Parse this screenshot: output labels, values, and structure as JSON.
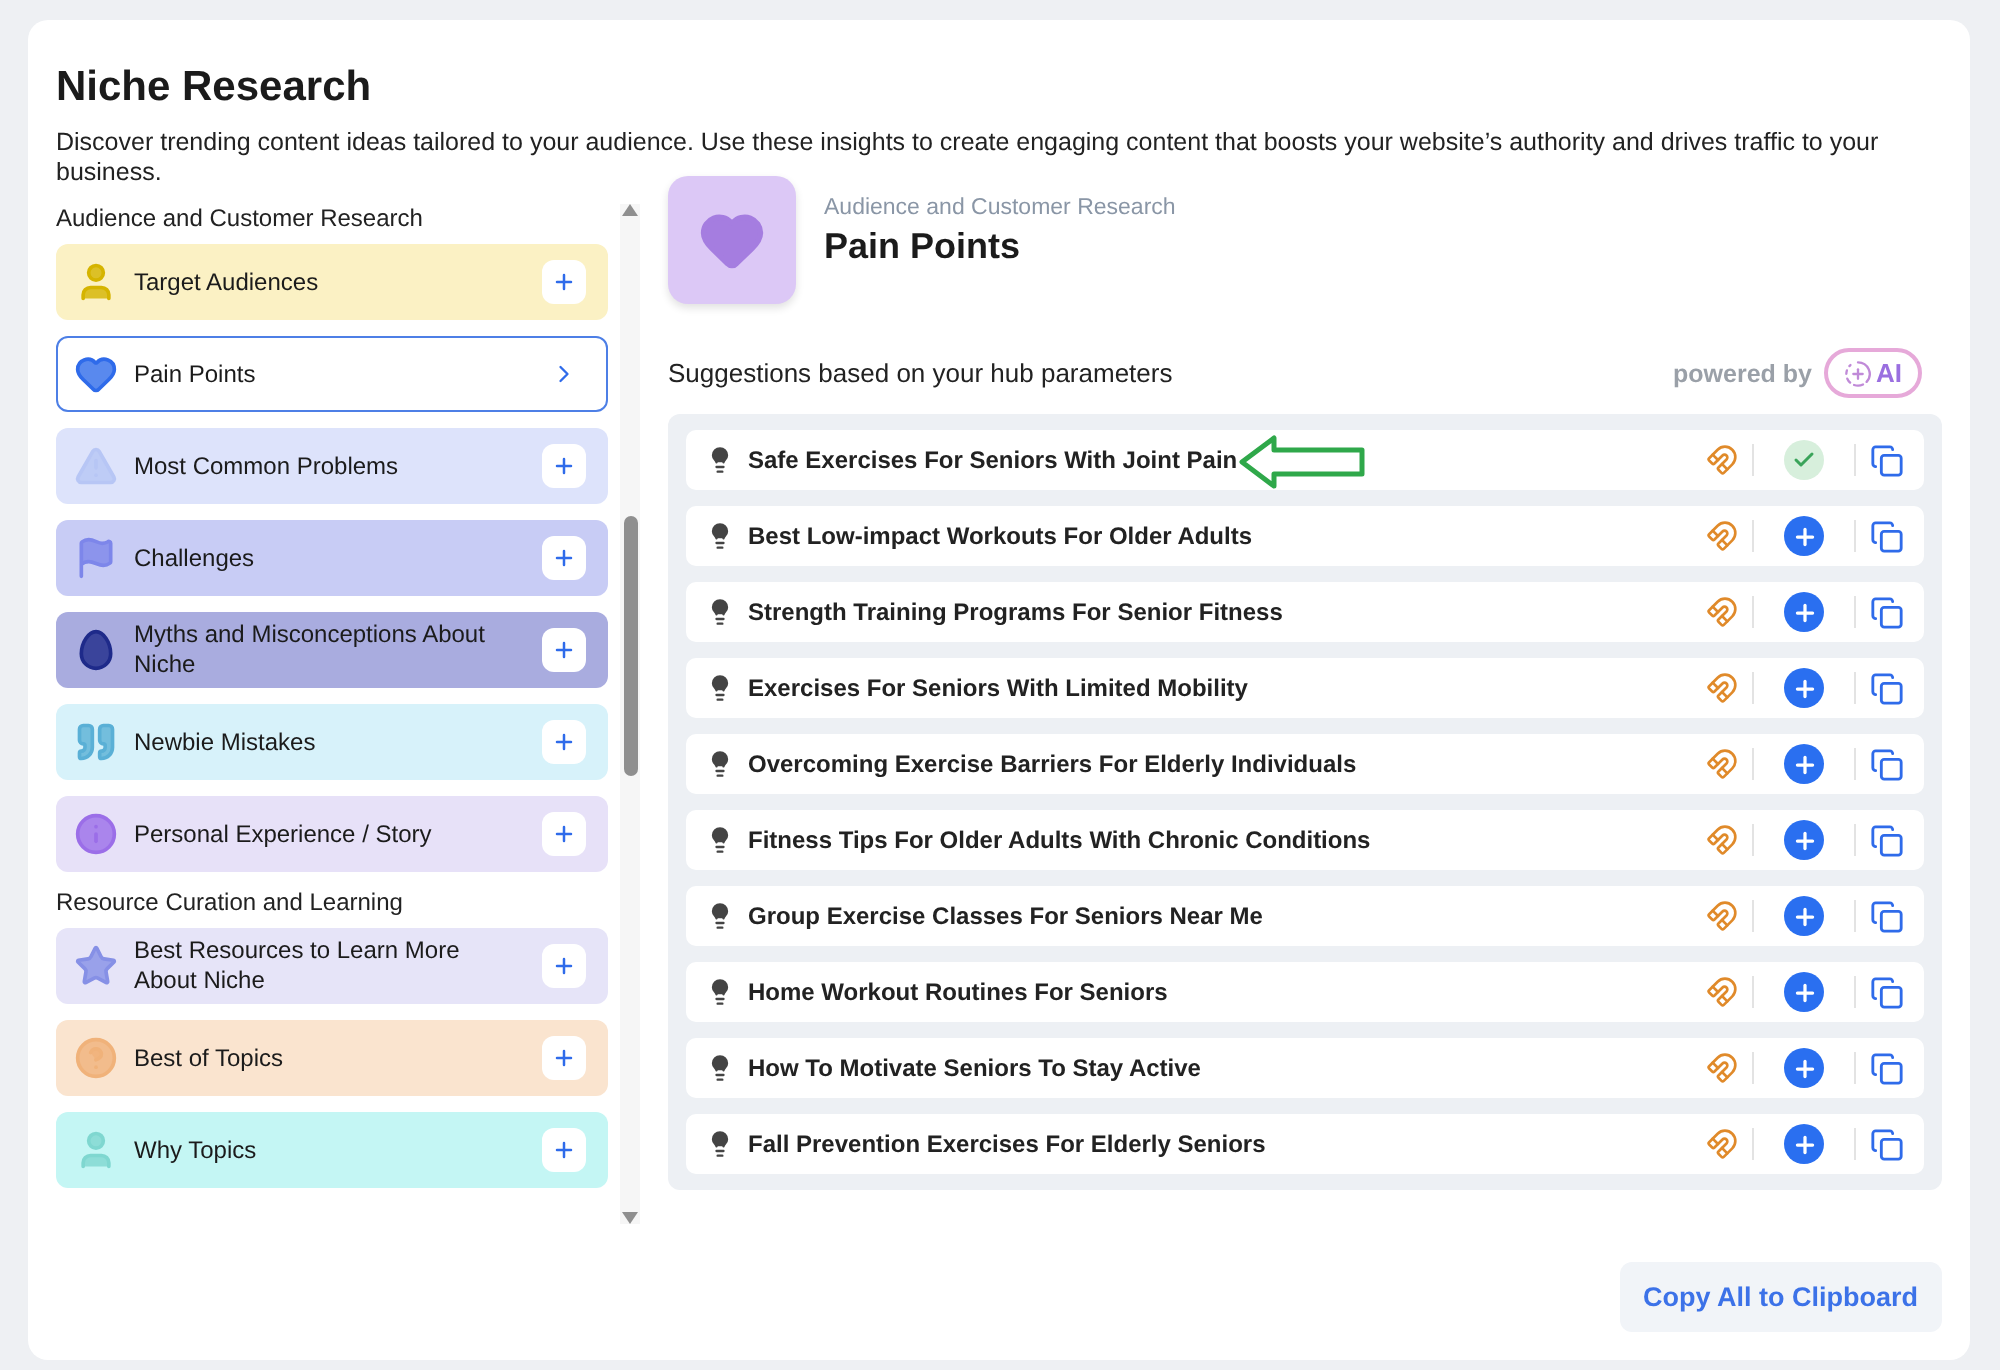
{
  "page": {
    "title": "Niche Research",
    "description": "Discover trending content ideas tailored to your audience. Use these insights to create engaging content that boosts your website’s authority and drives traffic to your business."
  },
  "sidebar": {
    "sections": [
      {
        "heading": "Audience and Customer Research",
        "items": [
          {
            "label": "Target Audiences",
            "color": "#fbf1c4",
            "selected": false
          },
          {
            "label": "Pain Points",
            "color": "#ffffff",
            "selected": true
          },
          {
            "label": "Most Common Problems",
            "color": "#dde3fb",
            "selected": false
          },
          {
            "label": "Challenges",
            "color": "#c8ccf5",
            "selected": false
          },
          {
            "label": "Myths and Misconceptions About Niche",
            "color": "#a9acdf",
            "selected": false
          },
          {
            "label": "Newbie Mistakes",
            "color": "#d7f2fa",
            "selected": false
          },
          {
            "label": "Personal Experience / Story",
            "color": "#e7e1f8",
            "selected": false
          }
        ]
      },
      {
        "heading": "Resource Curation and Learning",
        "items": [
          {
            "label": "Best Resources to Learn More About Niche",
            "color": "#e6e4f8",
            "selected": false
          },
          {
            "label": "Best of Topics",
            "color": "#fae4cf",
            "selected": false
          },
          {
            "label": "Why Topics",
            "color": "#c4f6f4",
            "selected": false
          }
        ]
      }
    ]
  },
  "detail": {
    "category": "Audience and Customer Research",
    "title": "Pain Points",
    "suggestions_label": "Suggestions based on your hub parameters",
    "powered_by": "powered by",
    "ai_badge": "AI",
    "suggestions": [
      {
        "text": "Safe Exercises For Seniors With Joint Pain",
        "added": true
      },
      {
        "text": "Best Low-impact Workouts For Older Adults",
        "added": false
      },
      {
        "text": "Strength Training Programs For Senior Fitness",
        "added": false
      },
      {
        "text": "Exercises For Seniors With Limited Mobility",
        "added": false
      },
      {
        "text": "Overcoming Exercise Barriers For Elderly Individuals",
        "added": false
      },
      {
        "text": "Fitness Tips For Older Adults With Chronic Conditions",
        "added": false
      },
      {
        "text": "Group Exercise Classes For Seniors Near Me",
        "added": false
      },
      {
        "text": "Home Workout Routines For Seniors",
        "added": false
      },
      {
        "text": "How To Motivate Seniors To Stay Active",
        "added": false
      },
      {
        "text": "Fall Prevention Exercises For Elderly Seniors",
        "added": false
      }
    ],
    "copy_button": "Copy All to Clipboard"
  }
}
